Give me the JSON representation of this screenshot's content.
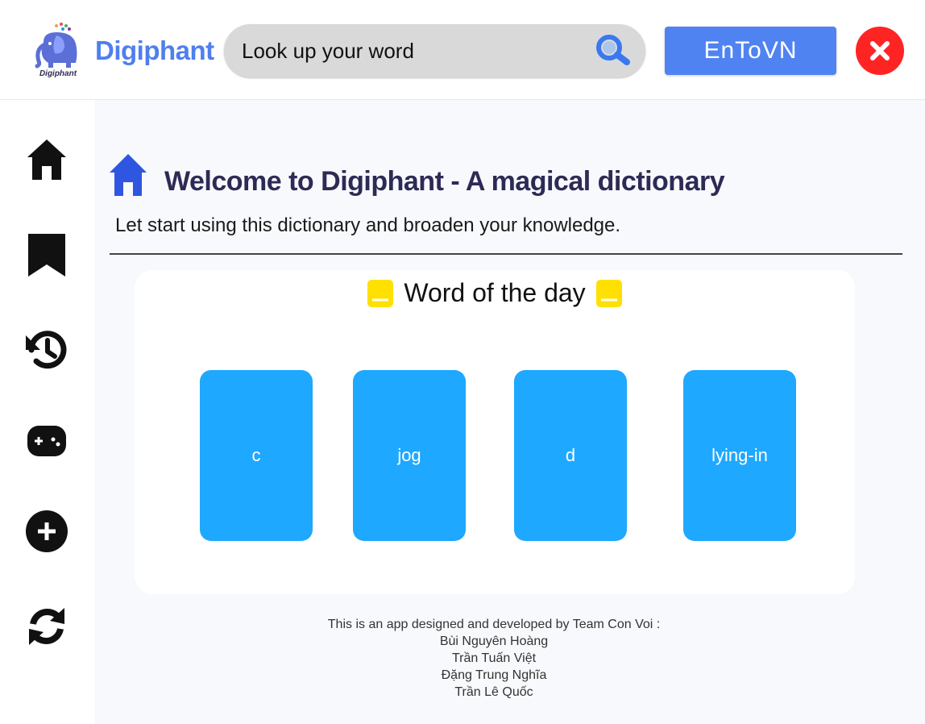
{
  "header": {
    "brand": "Digiphant",
    "logo_text": "Digiphant",
    "search": {
      "placeholder": "Look up your word",
      "value": ""
    },
    "lang_button_label": "EnToVN",
    "icons": {
      "search": "search-icon",
      "close": "close-icon"
    },
    "colors": {
      "brand": "#4f7fee",
      "lang_button": "#5083f2",
      "close": "#ff2424"
    }
  },
  "sidebar": {
    "items": [
      {
        "name": "home",
        "icon": "home-icon"
      },
      {
        "name": "bookmark",
        "icon": "bookmark-icon"
      },
      {
        "name": "history",
        "icon": "history-icon"
      },
      {
        "name": "game",
        "icon": "gamepad-icon"
      },
      {
        "name": "add",
        "icon": "add-icon"
      },
      {
        "name": "sync",
        "icon": "sync-icon"
      }
    ]
  },
  "main": {
    "title": "Welcome to Digiphant - A magical dictionary",
    "subtitle": "Let start using this dictionary and broaden your knowledge.",
    "word_of_the_day": {
      "title": "Word of the day",
      "words": [
        "c",
        "jog",
        "d",
        "lying-in"
      ],
      "tile_color": "#1ea8ff"
    },
    "footer": {
      "intro": "This is an app designed and developed by Team Con Voi :",
      "members": [
        "Bùi Nguyên Hoàng",
        "Trần Tuấn Việt",
        "Đặng Trung Nghĩa",
        "Trần Lê Quốc"
      ]
    }
  }
}
